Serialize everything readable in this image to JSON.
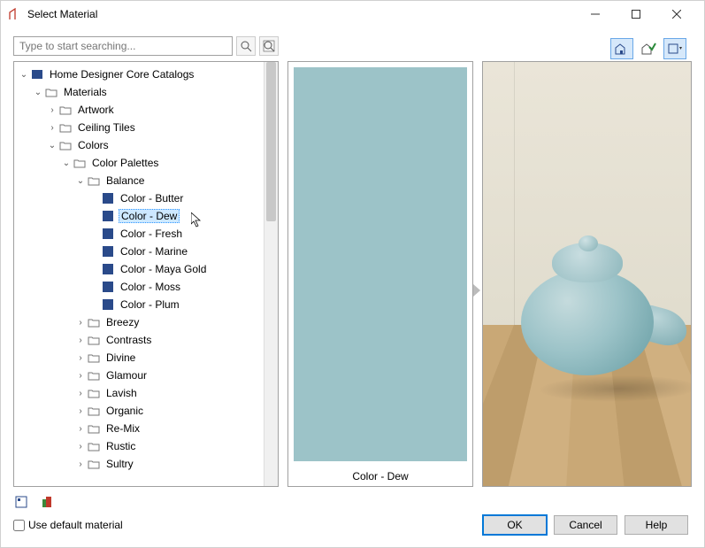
{
  "window": {
    "title": "Select Material"
  },
  "search": {
    "placeholder": "Type to start searching..."
  },
  "tree": {
    "root": "Home Designer Core Catalogs",
    "materials": "Materials",
    "artwork": "Artwork",
    "ceiling": "Ceiling Tiles",
    "colors": "Colors",
    "palettes": "Color Palettes",
    "balance": "Balance",
    "c_butter": "Color - Butter",
    "c_dew": "Color - Dew",
    "c_fresh": "Color - Fresh",
    "c_marine": "Color - Marine",
    "c_maya": "Color - Maya Gold",
    "c_moss": "Color - Moss",
    "c_plum": "Color - Plum",
    "breezy": "Breezy",
    "contrasts": "Contrasts",
    "divine": "Divine",
    "glamour": "Glamour",
    "lavish": "Lavish",
    "organic": "Organic",
    "remix": "Re-Mix",
    "rustic": "Rustic",
    "sultry": "Sultry"
  },
  "swatch": {
    "label": "Color - Dew",
    "color": "#9cc3c8"
  },
  "checkbox": {
    "label": "Use default material"
  },
  "buttons": {
    "ok": "OK",
    "cancel": "Cancel",
    "help": "Help"
  }
}
